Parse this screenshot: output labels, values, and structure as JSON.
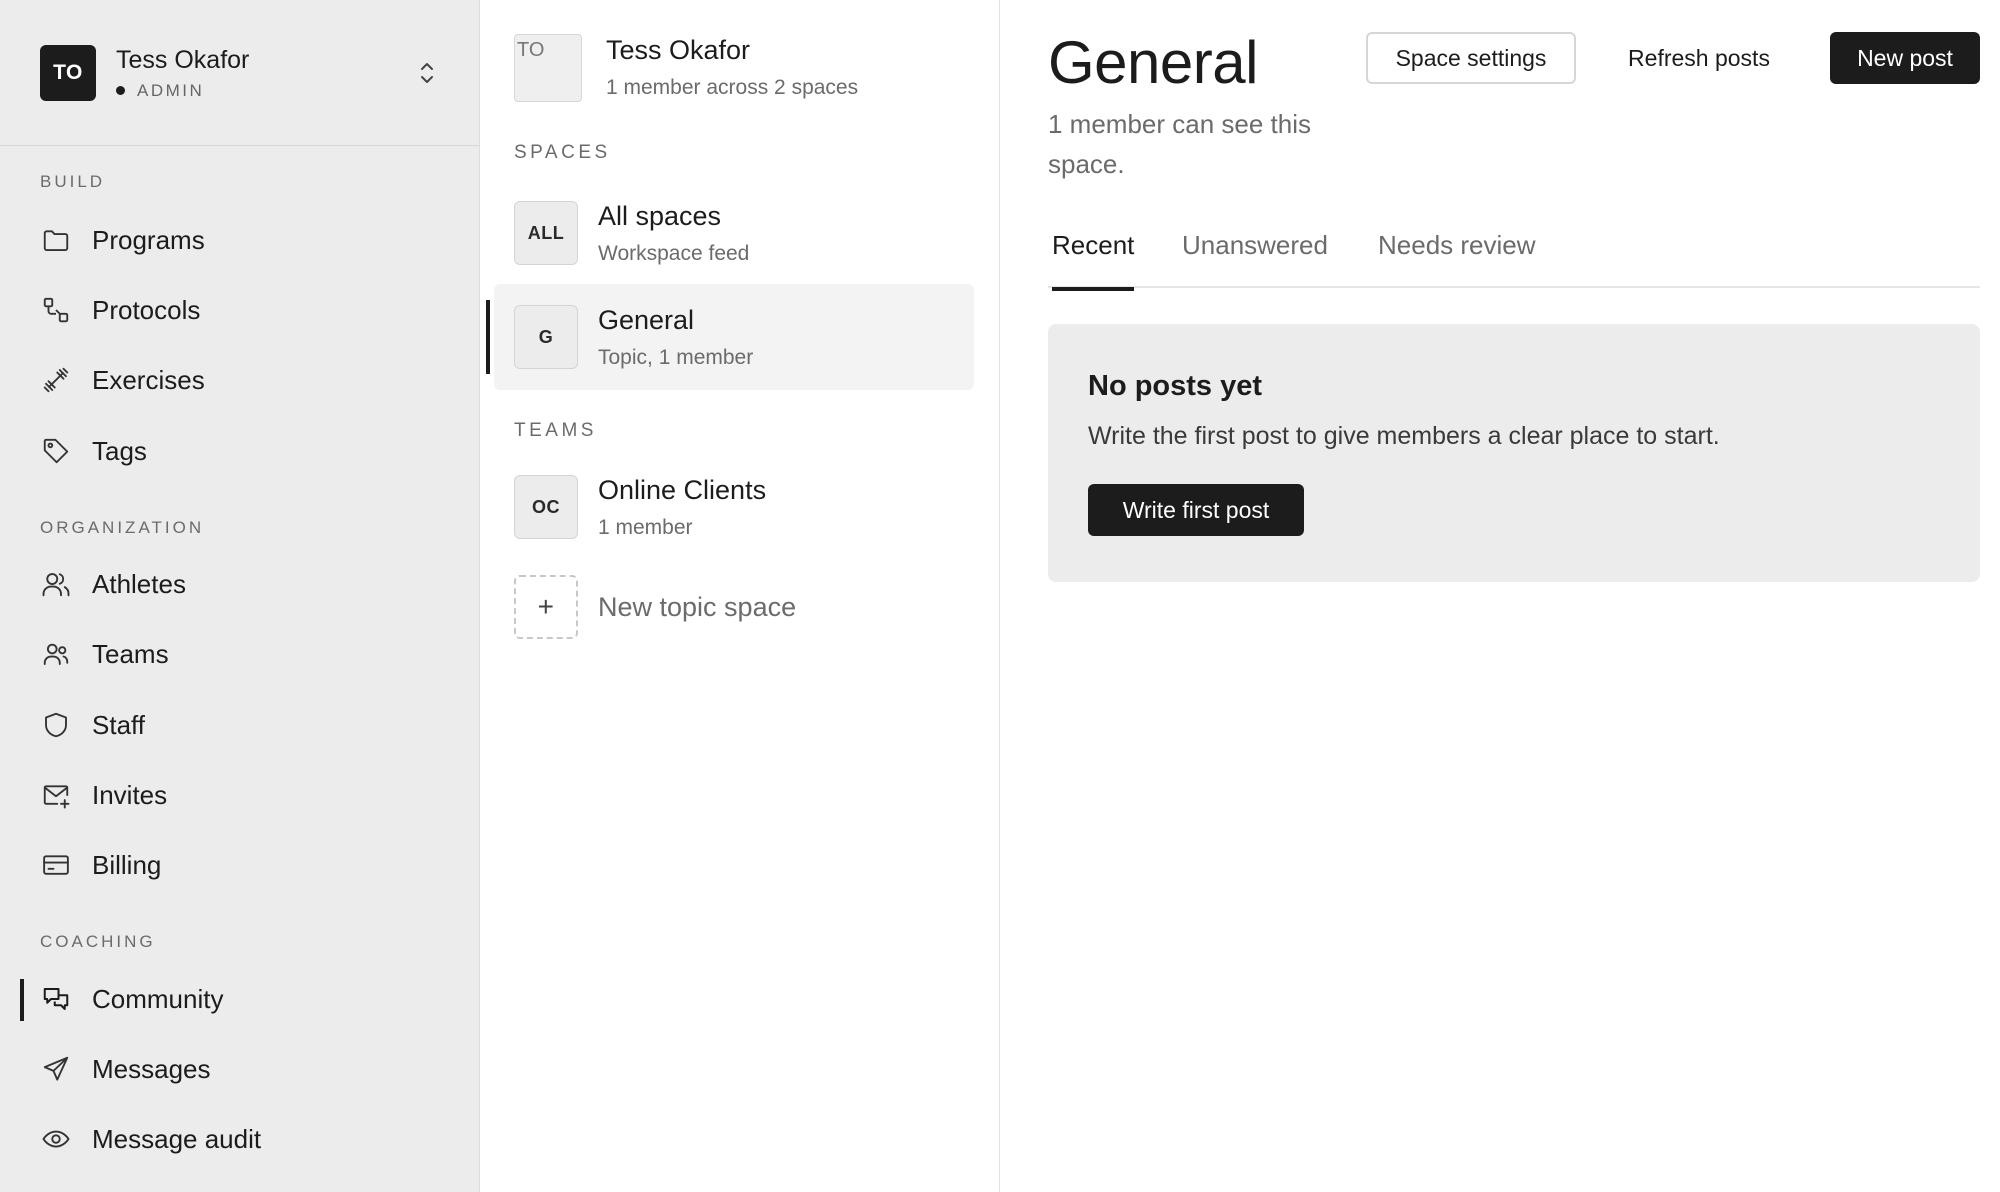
{
  "account": {
    "initials": "TO",
    "name": "Tess Okafor",
    "role": "ADMIN"
  },
  "nav": {
    "sections": {
      "build": "BUILD",
      "organization": "ORGANIZATION",
      "coaching": "COACHING"
    },
    "items": {
      "programs": "Programs",
      "protocols": "Protocols",
      "exercises": "Exercises",
      "tags": "Tags",
      "athletes": "Athletes",
      "teams": "Teams",
      "staff": "Staff",
      "invites": "Invites",
      "billing": "Billing",
      "community": "Community",
      "messages": "Messages",
      "message_audit": "Message audit"
    },
    "active": "community"
  },
  "spaces_panel": {
    "owner": {
      "initials": "TO",
      "name": "Tess Okafor",
      "summary": "1 member across 2 spaces"
    },
    "spaces_label": "SPACES",
    "teams_label": "TEAMS",
    "spaces": [
      {
        "badge": "ALL",
        "name": "All spaces",
        "sub": "Workspace feed"
      },
      {
        "badge": "G",
        "name": "General",
        "sub": "Topic, 1 member"
      }
    ],
    "teams": [
      {
        "badge": "OC",
        "name": "Online Clients",
        "sub": "1 member"
      }
    ],
    "new_space": {
      "badge": "+",
      "label": "New topic space"
    }
  },
  "main": {
    "title": "General",
    "subtitle": "1 member can see this space.",
    "buttons": {
      "settings": "Space settings",
      "refresh": "Refresh posts",
      "new_post": "New post"
    },
    "tabs": [
      "Recent",
      "Unanswered",
      "Needs review"
    ],
    "active_tab": "Recent",
    "empty": {
      "title": "No posts yet",
      "text": "Write the first post to give members a clear place to start.",
      "button": "Write first post"
    }
  }
}
